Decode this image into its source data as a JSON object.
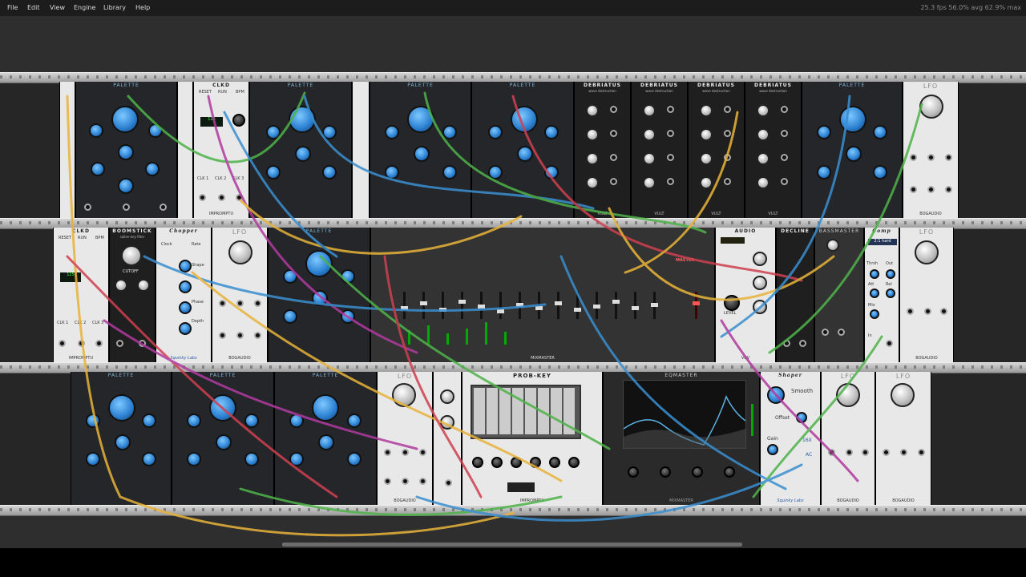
{
  "menu": {
    "file": "File",
    "edit": "Edit",
    "view": "View",
    "engine": "Engine",
    "library": "Library",
    "help": "Help"
  },
  "stats": "25.3 fps   56.0% avg   62.9% max",
  "modules": {
    "palette": "PALETTE",
    "clkd": "CLKD",
    "debriatus": "DEBRIATUS",
    "debriatus_sub": "wave destruction",
    "vult": "VULT",
    "lfo": "LFO",
    "bogaudio": "BOGAUDIO",
    "impromptu": "IMPROMPTU",
    "boomstick": "BOOMSTICK",
    "boomstick_sub": "sallen-key filter",
    "chopper": "Chopper",
    "squinky": "Squinky Labs",
    "mixmaster": "MIXMASTER",
    "master": "MASTER",
    "audio": "AUDIO",
    "vcv": "VCV",
    "decline": "DECLINE",
    "bassmaster": "BASSMASTER",
    "comp": "Comp",
    "probkey": "PROB-KEY",
    "eqmaster": "EQMASTER",
    "shaper": "Shaper",
    "smooth": "Smooth",
    "offset": "Offset",
    "gain": "Gain",
    "x16": "16X",
    "ac": "AC",
    "cutoff": "CUTOFF",
    "rate": "Rate",
    "phase": "Phase",
    "depth": "Depth",
    "shape": "Shape",
    "clock": "Clock",
    "reset": "RESET",
    "run": "RUN",
    "bpm": "BPM",
    "clk1": "CLK 1",
    "clk2": "CLK 2",
    "clk3": "CLK 3",
    "ratio": "2:1 hard",
    "level": "LEVEL",
    "thrsh": "Thrsh",
    "att": "Att",
    "rel": "Rel",
    "mix": "Mix",
    "in": "In",
    "out": "Out"
  },
  "colors": {
    "workspace": "#2e2e2e",
    "rail": "#c0c0c0",
    "accent_blue": "#2a7fd0"
  }
}
